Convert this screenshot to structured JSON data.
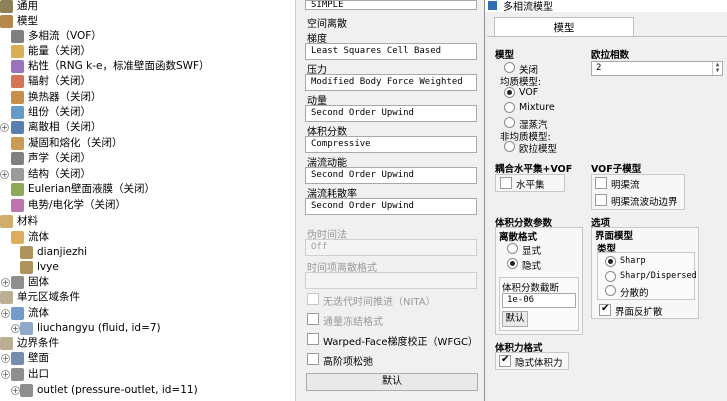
{
  "tree": {
    "items": [
      {
        "label": "通用",
        "icon": "general-icon"
      },
      {
        "label": "模型",
        "icon": "models-icon"
      },
      {
        "label": "多相流（VOF）",
        "icon": "multiphase-icon"
      },
      {
        "label": "能量（关闭）",
        "icon": "energy-icon"
      },
      {
        "label": "粘性（RNG k-e，标准壁面函数SWF）",
        "icon": "viscous-icon"
      },
      {
        "label": "辐射（关闭）",
        "icon": "radiation-icon"
      },
      {
        "label": "换热器（关闭）",
        "icon": "heat-exchanger-icon"
      },
      {
        "label": "组份（关闭）",
        "icon": "species-icon"
      },
      {
        "label": "离散相（关闭）",
        "icon": "discrete-phase-icon"
      },
      {
        "label": "凝固和熔化（关闭）",
        "icon": "solidification-icon"
      },
      {
        "label": "声学（关闭）",
        "icon": "acoustics-icon"
      },
      {
        "label": "结构（关闭）",
        "icon": "structure-icon"
      },
      {
        "label": "Eulerian壁面液膜（关闭）",
        "icon": "wall-film-icon"
      },
      {
        "label": "电势/电化学（关闭）",
        "icon": "electric-potential-icon"
      },
      {
        "label": "材料",
        "icon": "materials-icon"
      },
      {
        "label": "流体",
        "icon": "fluid-icon"
      },
      {
        "label": "dianjiezhi",
        "icon": "fluid-material-icon"
      },
      {
        "label": "lvye",
        "icon": "fluid-material-icon"
      },
      {
        "label": "固体",
        "icon": "solid-icon"
      },
      {
        "label": "单元区域条件",
        "icon": "cell-zone-icon"
      },
      {
        "label": "流体",
        "icon": "fluid-zone-icon"
      },
      {
        "label": "liuchangyu (fluid, id=7)",
        "icon": "zone-item-icon"
      },
      {
        "label": "边界条件",
        "icon": "boundary-icon"
      },
      {
        "label": "壁面",
        "icon": "wall-icon"
      },
      {
        "label": "出口",
        "icon": "outlet-icon"
      },
      {
        "label": "outlet (pressure-outlet, id=11)",
        "icon": "outlet-item-icon"
      }
    ]
  },
  "methods": {
    "top_value": "SIMPLE",
    "spatial_label": "空间离散",
    "gradient_label": "梯度",
    "gradient_value": "Least Squares Cell Based",
    "pressure_label": "压力",
    "pressure_value": "Modified Body Force Weighted",
    "momentum_label": "动量",
    "momentum_value": "Second Order Upwind",
    "volume_fraction_label": "体积分数",
    "volume_fraction_value": "Compressive",
    "tke_label": "湍流动能",
    "tke_value": "Second Order Upwind",
    "tdr_label": "湍流耗散率",
    "tdr_value": "Second Order Upwind",
    "transient_label": "伪时间法",
    "transient_value": "Off",
    "transient_formulation_label": "时间项离散格式",
    "nita_label": "无迭代时间推进（NITA）",
    "frozen_flux_label": "通量冻结格式",
    "warped_face_label": "Warped-Face梯度校正（WFGC）",
    "high_order_label": "高阶项松弛",
    "default_button": "默认"
  },
  "dialog": {
    "title": "多相流模型",
    "tab": "模型",
    "model_label": "模型",
    "model_options": [
      "关闭",
      "VOF",
      "Mixture",
      "湿蒸汽",
      "欧拉模型"
    ],
    "homogeneous_label": "均质模型:",
    "inhomogeneous_label": "非均质模型:",
    "eulerian_phases_label": "欧拉相数",
    "eulerian_phases_value": "2",
    "coupled_label": "耦合水平集+VOF",
    "level_set_label": "水平集",
    "vof_submodels_label": "VOF子模型",
    "open_channel_flow_label": "明渠流",
    "open_channel_wave_label": "明渠流波动边界",
    "vf_params_label": "体积分数参数",
    "scheme_label": "离散格式",
    "explicit_label": "显式",
    "implicit_label": "隐式",
    "cutoff_label": "体积分数截断",
    "cutoff_value": "1e-06",
    "cutoff_default_button": "默认",
    "options_label": "选项",
    "interface_label": "界面模型",
    "type_label": "类型",
    "sharp_label": "Sharp",
    "sharp_dispersed_label": "Sharp/Dispersed",
    "dispersed_label": "分散的",
    "anti_diffusion_label": "界面反扩散",
    "body_force_label": "体积力格式",
    "implicit_body_force_label": "隐式体积力"
  }
}
